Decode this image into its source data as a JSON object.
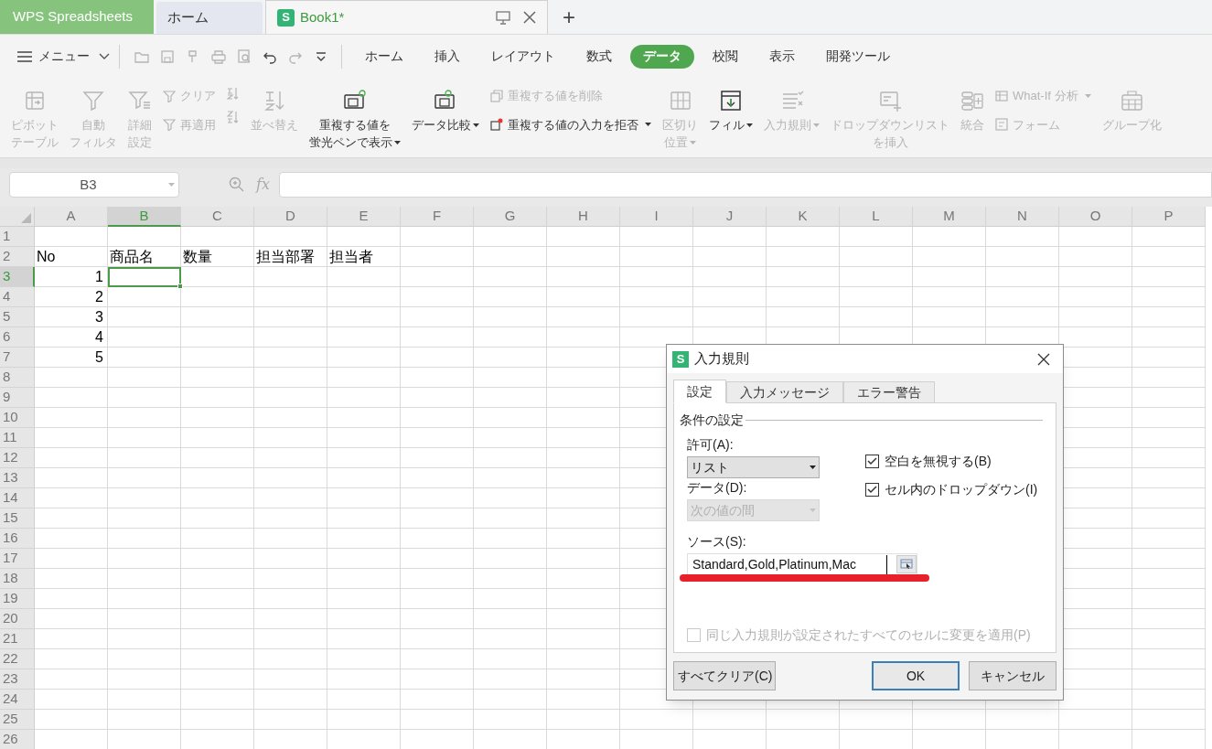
{
  "title_bar": {
    "tabs": [
      {
        "label": "WPS Spreadsheets",
        "kind": "app",
        "selected": false
      },
      {
        "label": "ホーム",
        "kind": "tab",
        "selected": false
      },
      {
        "label": "Book1*",
        "kind": "doc",
        "selected": true,
        "logo": "S"
      }
    ],
    "new_tab": "+"
  },
  "menu_bar": {
    "menu": "メニュー",
    "quick_access": [
      {
        "disabled": true
      },
      {
        "disabled": true
      },
      {
        "disabled": true
      },
      {
        "disabled": true
      },
      {
        "disabled": true
      },
      {
        "disabled": false
      },
      {
        "disabled": true
      },
      {
        "disabled": false
      }
    ],
    "tabs": [
      {
        "label": "ホーム",
        "selected": false
      },
      {
        "label": "挿入",
        "selected": false
      },
      {
        "label": "レイアウト",
        "selected": false
      },
      {
        "label": "数式",
        "selected": false
      },
      {
        "label": "データ",
        "selected": true
      },
      {
        "label": "校閲",
        "selected": false
      },
      {
        "label": "表示",
        "selected": false
      },
      {
        "label": "開発ツール",
        "selected": false
      }
    ]
  },
  "ribbon": [
    {
      "kind": "large",
      "lines": [
        "ピボット",
        "テーブル"
      ],
      "disabled": true,
      "dropdown": false
    },
    {
      "kind": "large",
      "lines": [
        "自動",
        "フィルタ"
      ],
      "disabled": true,
      "dropdown": false
    },
    {
      "kind": "large",
      "lines": [
        "詳細",
        "設定"
      ],
      "disabled": true,
      "dropdown": false
    },
    {
      "kind": "stack",
      "items": [
        {
          "label": "クリア",
          "disabled": true,
          "dropdown": false
        },
        {
          "label": "再適用",
          "disabled": true,
          "dropdown": false
        }
      ]
    },
    {
      "kind": "stack",
      "items": [
        {
          "disabled": true,
          "dropdown": false
        },
        {
          "disabled": true,
          "dropdown": false
        }
      ]
    },
    {
      "kind": "large",
      "lines": [
        "並べ替え"
      ],
      "disabled": true,
      "dropdown": false
    },
    {
      "kind": "large",
      "lines": [
        "重複する値を",
        "蛍光ペンで表示"
      ],
      "disabled": false,
      "dropdown": true
    },
    {
      "kind": "large",
      "lines": [
        "データ比較"
      ],
      "disabled": false,
      "dropdown": true
    },
    {
      "kind": "stack",
      "items": [
        {
          "label": "重複する値を削除",
          "disabled": true,
          "dropdown": false
        },
        {
          "label": "重複する値の入力を拒否",
          "disabled": false,
          "dropdown": true
        }
      ]
    },
    {
      "kind": "large",
      "lines": [
        "区切り",
        "位置"
      ],
      "disabled": true,
      "dropdown": true
    },
    {
      "kind": "large",
      "lines": [
        "フィル"
      ],
      "disabled": false,
      "dropdown": true
    },
    {
      "kind": "large",
      "lines": [
        "入力規則"
      ],
      "disabled": true,
      "dropdown": true
    },
    {
      "kind": "large",
      "lines": [
        "ドロップダウンリスト",
        "を挿入"
      ],
      "disabled": true,
      "dropdown": false
    },
    {
      "kind": "large",
      "lines": [
        "統合"
      ],
      "disabled": true,
      "dropdown": false
    },
    {
      "kind": "stack",
      "items": [
        {
          "label": "What-If 分析",
          "disabled": true,
          "dropdown": true
        },
        {
          "label": "フォーム",
          "disabled": true,
          "dropdown": false
        }
      ]
    },
    {
      "kind": "large",
      "lines": [
        "グループ化"
      ],
      "disabled": true,
      "dropdown": false
    }
  ],
  "formula_bar": {
    "name_box": "B3",
    "fx": "fx"
  },
  "sheet": {
    "columns": [
      {
        "label": "A",
        "selected": false
      },
      {
        "label": "B",
        "selected": true
      },
      {
        "label": "C",
        "selected": false
      },
      {
        "label": "D",
        "selected": false
      },
      {
        "label": "E",
        "selected": false
      },
      {
        "label": "F",
        "selected": false
      },
      {
        "label": "G",
        "selected": false
      },
      {
        "label": "H",
        "selected": false
      },
      {
        "label": "I",
        "selected": false
      },
      {
        "label": "J",
        "selected": false
      },
      {
        "label": "K",
        "selected": false
      },
      {
        "label": "L",
        "selected": false
      },
      {
        "label": "M",
        "selected": false
      },
      {
        "label": "N",
        "selected": false
      },
      {
        "label": "O",
        "selected": false
      },
      {
        "label": "P",
        "selected": false
      }
    ],
    "rows": [
      {
        "label": "1",
        "selected": false
      },
      {
        "label": "2",
        "selected": false,
        "cells": [
          {
            "text": "No",
            "kind": "text"
          },
          {
            "text": "商品名",
            "kind": "text"
          },
          {
            "text": "数量",
            "kind": "text"
          },
          {
            "text": "担当部署",
            "kind": "text"
          },
          {
            "text": "担当者",
            "kind": "text"
          }
        ]
      },
      {
        "label": "3",
        "selected": true,
        "cells": [
          {
            "text": "1",
            "kind": "number"
          }
        ]
      },
      {
        "label": "4",
        "selected": false,
        "cells": [
          {
            "text": "2",
            "kind": "number"
          }
        ]
      },
      {
        "label": "5",
        "selected": false,
        "cells": [
          {
            "text": "3",
            "kind": "number"
          }
        ]
      },
      {
        "label": "6",
        "selected": false,
        "cells": [
          {
            "text": "4",
            "kind": "number"
          }
        ]
      },
      {
        "label": "7",
        "selected": false,
        "cells": [
          {
            "text": "5",
            "kind": "number"
          }
        ]
      },
      {
        "label": "8",
        "selected": false
      },
      {
        "label": "9",
        "selected": false
      },
      {
        "label": "10",
        "selected": false
      },
      {
        "label": "11",
        "selected": false
      },
      {
        "label": "12",
        "selected": false
      },
      {
        "label": "13",
        "selected": false
      },
      {
        "label": "14",
        "selected": false
      },
      {
        "label": "15",
        "selected": false
      },
      {
        "label": "16",
        "selected": false
      },
      {
        "label": "17",
        "selected": false
      },
      {
        "label": "18",
        "selected": false
      },
      {
        "label": "19",
        "selected": false
      },
      {
        "label": "20",
        "selected": false
      },
      {
        "label": "21",
        "selected": false
      },
      {
        "label": "22",
        "selected": false
      },
      {
        "label": "23",
        "selected": false
      },
      {
        "label": "24",
        "selected": false
      },
      {
        "label": "25",
        "selected": false
      },
      {
        "label": "26",
        "selected": false
      }
    ]
  },
  "dialog": {
    "logo": "S",
    "title": "入力規則",
    "tabs": [
      {
        "label": "設定",
        "selected": true
      },
      {
        "label": "入力メッセージ",
        "selected": false
      },
      {
        "label": "エラー警告",
        "selected": false
      }
    ],
    "section": "条件の設定",
    "allow": {
      "label": "許可(A):",
      "value": "リスト",
      "disabled": false
    },
    "data": {
      "label": "データ(D):",
      "value": "次の値の間",
      "disabled": true
    },
    "checkboxes": [
      {
        "label": "空白を無視する(B)",
        "checked": true,
        "disabled": false
      },
      {
        "label": "セル内のドロップダウン(I)",
        "checked": true,
        "disabled": false
      }
    ],
    "source": {
      "label": "ソース(S):",
      "value": "Standard,Gold,Platinum,Mac"
    },
    "apply_all": {
      "label": "同じ入力規則が設定されたすべてのセルに変更を適用(P)",
      "checked": false,
      "disabled": true
    },
    "buttons": [
      {
        "label": "すべてクリア(C)",
        "default": false,
        "kind": "left"
      },
      {
        "label": "OK",
        "default": true,
        "kind": "right"
      },
      {
        "label": "キャンセル",
        "default": false,
        "kind": "right"
      }
    ]
  }
}
